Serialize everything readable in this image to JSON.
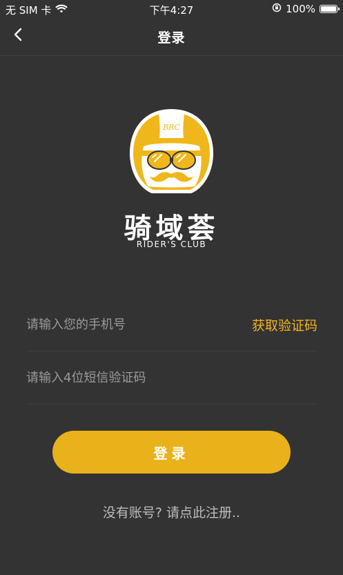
{
  "status_bar": {
    "carrier": "无 SIM 卡",
    "time": "下午4:27",
    "battery": "100%",
    "battery_level": 1.0,
    "icons": [
      "wifi-icon",
      "orientation-lock-icon",
      "battery-icon"
    ]
  },
  "nav": {
    "title": "登录",
    "back_icon": "chevron-left-icon"
  },
  "logo": {
    "brand_cn": "骑域荟",
    "brand_en": "RIDER'S CLUB",
    "helmet_text": "BRC",
    "colors": {
      "helmet": "#f0b71b",
      "outline": "#ffffff",
      "dark": "#333333"
    }
  },
  "form": {
    "phone_placeholder": "请输入您的手机号",
    "phone_value": "",
    "get_code_label": "获取验证码",
    "code_placeholder": "请输入4位短信验证码",
    "code_value": ""
  },
  "login_button": {
    "label": "登录"
  },
  "register_link": {
    "label": "没有账号? 请点此注册.."
  },
  "colors": {
    "background": "#333333",
    "accent": "#f0b71b",
    "button": "#eab21a",
    "placeholder": "#9a9a9a",
    "divider": "#404040"
  }
}
